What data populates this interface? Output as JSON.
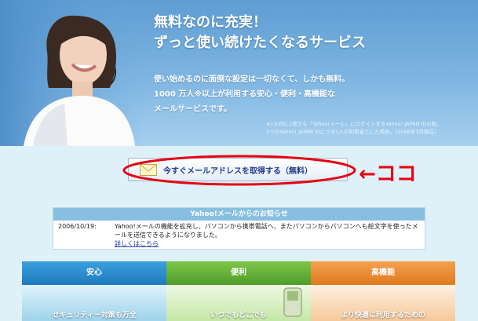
{
  "hero": {
    "headline_1": "無料なのに充実！",
    "headline_2": "ずっと使い続けたくなるサービス",
    "body_1": "使い始めるのに面倒な設定は一切なくて、しかも無料。",
    "body_2": "1000 万人※以上が利用する安心・便利・高機能な",
    "body_3": "メールサービスです。",
    "note_1": "※1か月に1度でも「Yahoo!メール」にログインするYahoo! JAPAN IDの数。",
    "note_2": "1つのYahoo! JAPAN IDにつき1人の利用者とした場合。（2006年3月現在）"
  },
  "cta": {
    "label": "今すぐメールアドレスを取得する（無料）"
  },
  "annotation": {
    "arrow_text": "←ココ",
    "accent": "#e60012"
  },
  "news": {
    "header": "Yahoo!メールからのお知らせ",
    "date": "2006/10/19:",
    "text": "Yahoo!メールの機能を拡充し、パソコンから携帯電話へ、またパソコンからパソコンへも絵文字を使ったメールを送信できるようになりました。",
    "link": "詳しくはこちら"
  },
  "tabs": [
    {
      "label": "安心",
      "sub": "セキュリティー対策も万全"
    },
    {
      "label": "便利",
      "sub": "いつでもどこでも"
    },
    {
      "label": "高機能",
      "sub": "より快適に利用するための"
    }
  ]
}
